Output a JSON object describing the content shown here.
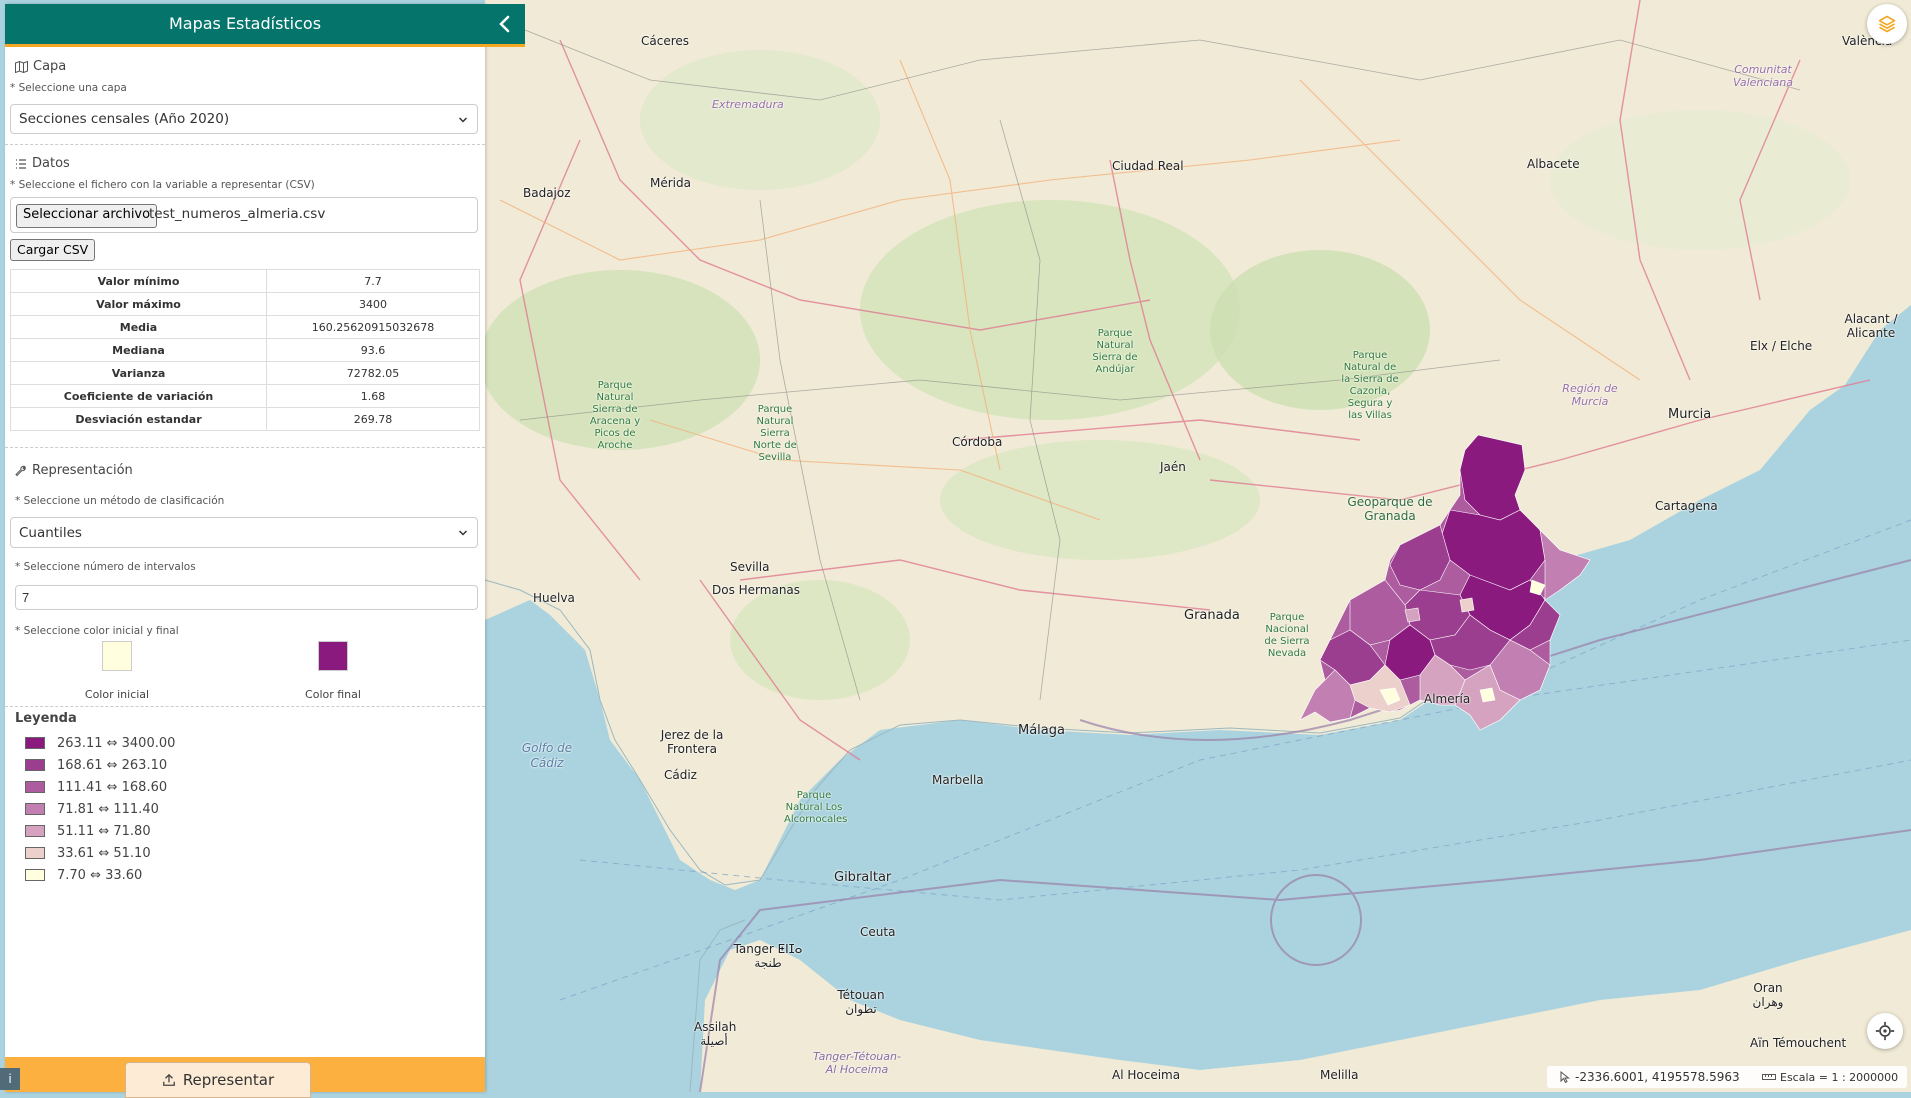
{
  "sidebar": {
    "title": "Mapas Estadísticos",
    "capa": {
      "title": "Capa",
      "required_label": "* Seleccione una capa",
      "selected": "Secciones censales (Año 2020)"
    },
    "datos": {
      "title": "Datos",
      "required_label": "* Seleccione el fichero con la variable a representar (CSV)",
      "file_button": "Seleccionar archivo",
      "file_name": "test_numeros_almeria.csv",
      "load_button": "Cargar CSV"
    },
    "stats": [
      {
        "label": "Valor mínimo",
        "value": "7.7"
      },
      {
        "label": "Valor máximo",
        "value": "3400"
      },
      {
        "label": "Media",
        "value": "160.25620915032678"
      },
      {
        "label": "Mediana",
        "value": "93.6"
      },
      {
        "label": "Varianza",
        "value": "72782.05"
      },
      {
        "label": "Coeficiente de variación",
        "value": "1.68"
      },
      {
        "label": "Desviación estandar",
        "value": "269.78"
      }
    ],
    "representacion": {
      "title": "Representación",
      "method_label": "* Seleccione un método de clasificación",
      "method_selected": "Cuantiles",
      "intervals_label": "* Seleccione número de intervalos",
      "intervals_value": "7",
      "color_label": "* Seleccione color inicial y final",
      "color_initial_caption": "Color inicial",
      "color_final_caption": "Color final",
      "color_initial": "#ffffe0",
      "color_final": "#8b1a7f"
    },
    "legend": {
      "title": "Leyenda",
      "items": [
        {
          "label": "263.11 ⇔ 3400.00",
          "color": "#8b1a7f"
        },
        {
          "label": "168.61 ⇔ 263.10",
          "color": "#9c3e8f"
        },
        {
          "label": "111.41 ⇔ 168.60",
          "color": "#ad5d9f"
        },
        {
          "label": "71.81 ⇔ 111.40",
          "color": "#c27fb2"
        },
        {
          "label": "51.11 ⇔ 71.80",
          "color": "#d5a3c0"
        },
        {
          "label": "33.61 ⇔ 51.10",
          "color": "#ecd0cc"
        },
        {
          "label": "7.70 ⇔ 33.60",
          "color": "#ffffe0"
        }
      ]
    },
    "represent_button": "Representar",
    "info_button": "i"
  },
  "map": {
    "coords": "-2336.6001, 4195578.5963",
    "scale": "Escala = 1 : 2000000",
    "labels": {
      "caceres": "Cáceres",
      "valencia": "València",
      "extremadura": "Extremadura",
      "comunitat": "Comunitat Valenciana",
      "ciudad_real": "Ciudad Real",
      "albacete": "Albacete",
      "badajoz": "Badajoz",
      "merida": "Mérida",
      "alicante": "Alacant / Alicante",
      "elx": "Elx / Elche",
      "region_murcia": "Región de Murcia",
      "murcia": "Murcia",
      "cartagena": "Cartagena",
      "cordoba": "Córdoba",
      "jaen": "Jaén",
      "sevilla": "Sevilla",
      "dos_hermanas": "Dos Hermanas",
      "huelva": "Huelva",
      "granada": "Granada",
      "geoparque": "Geoparque de Granada",
      "almeria": "Almería",
      "malaga": "Málaga",
      "marbella": "Marbella",
      "jerez": "Jerez de la Frontera",
      "cadiz": "Cádiz",
      "golfo": "Golfo de Cádiz",
      "gibraltar": "Gibraltar",
      "tanger": "Tanger ⵟⵏⵊⴰ طنجة",
      "ceuta": "Ceuta",
      "tetouan": "Tétouan تطوان",
      "assilah": "Assilah أصيلة",
      "tanger_tetouan": "Tanger-Tétouan-Al Hoceima",
      "al_hoceima": "Al Hoceima",
      "melilla": "Melilla",
      "oran": "Oran وهران",
      "ain": "Aïn Témouchent",
      "p_andujar": "Parque Natural Sierra de Andújar",
      "p_cazorla": "Parque Natural de la Sierra de Cazorla, Segura y las Villas",
      "p_aracena": "Parque Natural Sierra de Aracena y Picos de Aroche",
      "p_norte": "Parque Natural Sierra Norte de Sevilla",
      "p_nevada": "Parque Nacional de Sierra Nevada",
      "p_alcornocales": "Parque Natural Los Alcornocales"
    }
  }
}
